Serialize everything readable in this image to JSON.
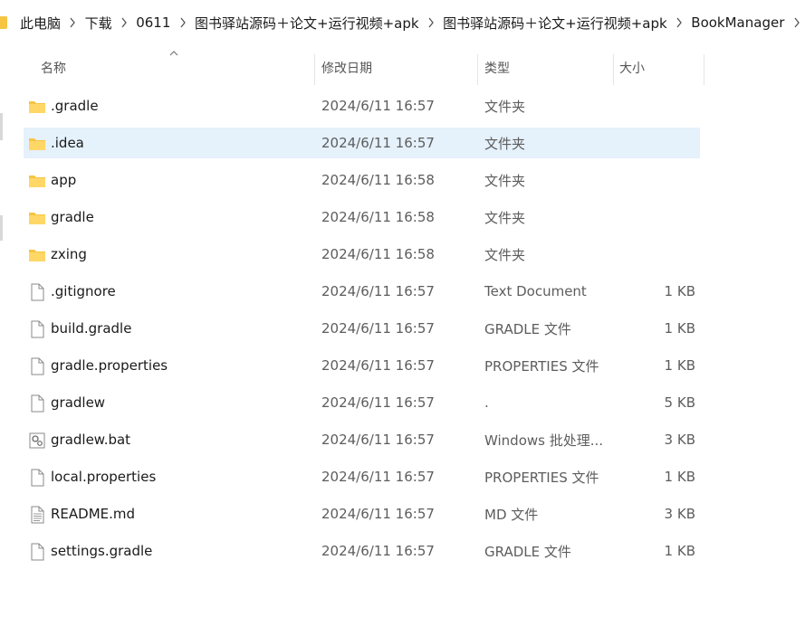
{
  "breadcrumb": [
    "此电脑",
    "下载",
    "0611",
    "图书驿站源码＋论文+运行视频+apk",
    "图书驿站源码＋论文+运行视频+apk",
    "BookManager"
  ],
  "columns": {
    "name": "名称",
    "date": "修改日期",
    "type": "类型",
    "size": "大小"
  },
  "files": [
    {
      "name": ".gradle",
      "date": "2024/6/11 16:57",
      "type": "文件夹",
      "size": "",
      "icon": "folder-icon"
    },
    {
      "name": ".idea",
      "date": "2024/6/11 16:57",
      "type": "文件夹",
      "size": "",
      "icon": "folder-icon",
      "selected": true
    },
    {
      "name": "app",
      "date": "2024/6/11 16:58",
      "type": "文件夹",
      "size": "",
      "icon": "folder-icon"
    },
    {
      "name": "gradle",
      "date": "2024/6/11 16:58",
      "type": "文件夹",
      "size": "",
      "icon": "folder-icon"
    },
    {
      "name": "zxing",
      "date": "2024/6/11 16:58",
      "type": "文件夹",
      "size": "",
      "icon": "folder-icon"
    },
    {
      "name": ".gitignore",
      "date": "2024/6/11 16:57",
      "type": "Text Document",
      "size": "1 KB",
      "icon": "file-icon"
    },
    {
      "name": "build.gradle",
      "date": "2024/6/11 16:57",
      "type": "GRADLE 文件",
      "size": "1 KB",
      "icon": "file-icon"
    },
    {
      "name": "gradle.properties",
      "date": "2024/6/11 16:57",
      "type": "PROPERTIES 文件",
      "size": "1 KB",
      "icon": "file-icon"
    },
    {
      "name": "gradlew",
      "date": "2024/6/11 16:57",
      "type": ".",
      "size": "5 KB",
      "icon": "file-icon"
    },
    {
      "name": "gradlew.bat",
      "date": "2024/6/11 16:57",
      "type": "Windows 批处理...",
      "size": "3 KB",
      "icon": "batch-file-icon"
    },
    {
      "name": "local.properties",
      "date": "2024/6/11 16:57",
      "type": "PROPERTIES 文件",
      "size": "1 KB",
      "icon": "file-icon"
    },
    {
      "name": "README.md",
      "date": "2024/6/11 16:57",
      "type": "MD 文件",
      "size": "3 KB",
      "icon": "text-file-icon"
    },
    {
      "name": "settings.gradle",
      "date": "2024/6/11 16:57",
      "type": "GRADLE 文件",
      "size": "1 KB",
      "icon": "file-icon"
    }
  ],
  "colors": {
    "folder": "#f5c543",
    "selected_row": "#e5f1fb"
  }
}
